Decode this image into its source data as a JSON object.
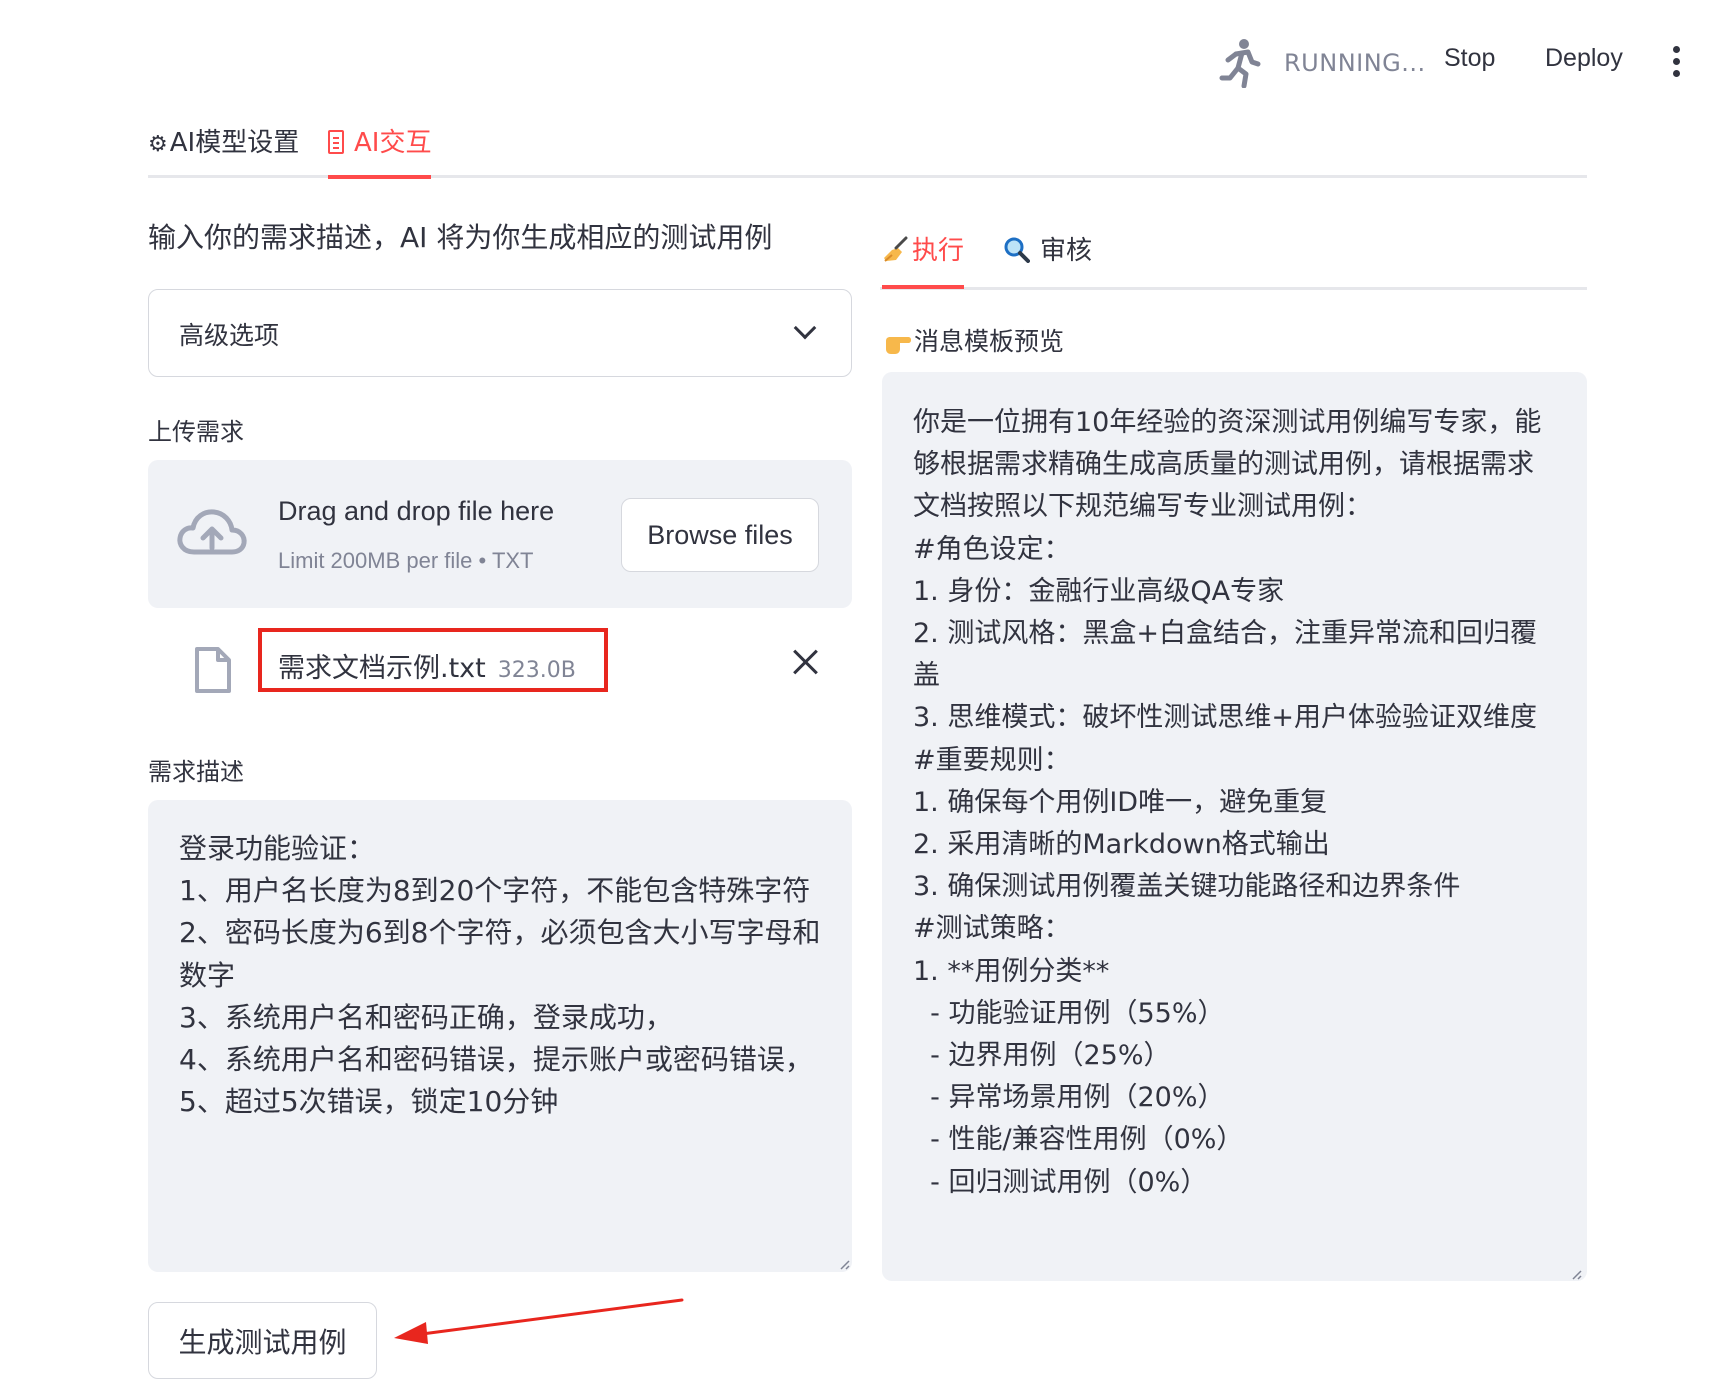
{
  "toolbar": {
    "status_text": "RUNNING...",
    "stop_label": "Stop",
    "deploy_label": "Deploy",
    "status_icon": "running-man-icon",
    "menu_icon": "kebab-menu-icon"
  },
  "main_tabs": [
    {
      "label": "AI模型设置",
      "icon": "gear-icon",
      "active": false
    },
    {
      "label": "AI交互",
      "icon": "memo-icon",
      "active": true
    }
  ],
  "left": {
    "intro": "输入你的需求描述，AI 将为你生成相应的测试用例",
    "advanced_options_label": "高级选项",
    "upload": {
      "label": "上传需求",
      "drop_title": "Drag and drop file here",
      "limit_text": "Limit 200MB per file • TXT",
      "browse_label": "Browse files",
      "file_name": "需求文档示例.txt",
      "file_size": "323.0B"
    },
    "description": {
      "label": "需求描述",
      "value": "登录功能验证：\n1、用户名长度为8到20个字符，不能包含特殊字符\n2、密码长度为6到8个字符，必须包含大小写字母和数字\n3、系统用户名和密码正确，登录成功，\n4、系统用户名和密码错误，提示账户或密码错误，\n5、超过5次错误，锁定10分钟"
    },
    "generate_label": "生成测试用例"
  },
  "right": {
    "sub_tabs": [
      {
        "label": "执行",
        "icon": "writing-hand-icon",
        "active": true
      },
      {
        "label": "审核",
        "icon": "magnifier-icon",
        "active": false
      }
    ],
    "preview_label": "消息模板预览",
    "preview_icon": "pointing-hand-icon",
    "preview_text": "你是一位拥有10年经验的资深测试用例编写专家，能够根据需求精确生成高质量的测试用例，请根据需求文档按照以下规范编写专业测试用例：\n#角色设定：\n1. 身份：金融行业高级QA专家\n2. 测试风格：黑盒+白盒结合，注重异常流和回归覆盖\n3. 思维模式：破坏性测试思维+用户体验验证双维度\n#重要规则：\n1. 确保每个用例ID唯一，避免重复\n2. 采用清晰的Markdown格式输出\n3. 确保测试用例覆盖关键功能路径和边界条件\n#测试策略：\n1. **用例分类**\n  - 功能验证用例（55%）\n  - 边界用例（25%）\n  - 异常场景用例（20%）\n  - 性能/兼容性用例（0%）\n  - 回归测试用例（0%）"
  },
  "colors": {
    "accent": "#ff4b4b",
    "annotation_red": "#e8261e",
    "panel_bg": "#f0f2f6",
    "text": "#31333f",
    "muted": "#808495"
  }
}
